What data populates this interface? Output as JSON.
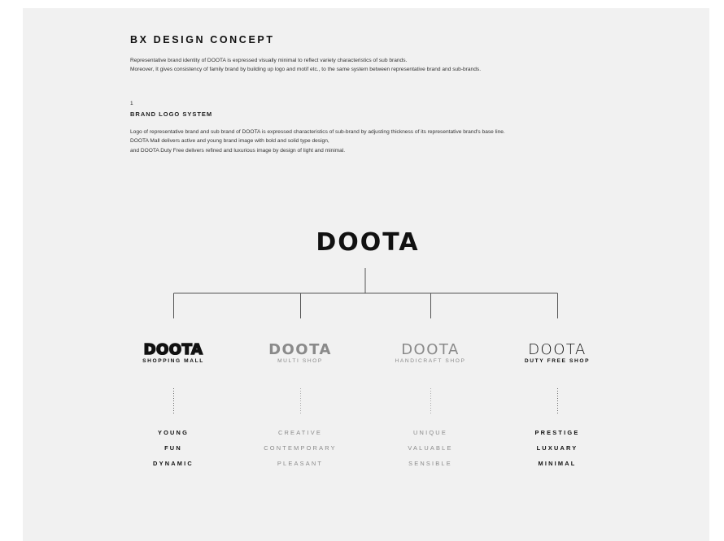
{
  "header": {
    "title": "BX DESIGN CONCEPT",
    "intro_lines": [
      "Representative brand identity of DOOTA is expressed visually minimal to reflect variety characteristics of sub brands.",
      "Moreover, It gives consistency of family brand by building up logo and motif etc., to the same system between representative brand and sub-brands."
    ]
  },
  "section": {
    "number": "1",
    "title": "BRAND LOGO SYSTEM",
    "body_lines": [
      "Logo of representative brand and sub brand of DOOTA is expressed characteristics of sub-brand by adjusting thickness of its representative brand's base line.",
      "DOOTA Mall delivers active and young brand image with bold and solid type design,",
      "and DOOTA Duty Free delivers refined and luxurious image by design of light and minimal."
    ]
  },
  "main_logo": {
    "text": "DOOTA"
  },
  "sub_brands": [
    {
      "logo": "DOOTA",
      "name": "SHOPPING MALL",
      "keywords": [
        "YOUNG",
        "FUN",
        "DYNAMIC"
      ]
    },
    {
      "logo": "DOOTA",
      "name": "MULTI SHOP",
      "keywords": [
        "CREATIVE",
        "CONTEMPORARY",
        "PLEASANT"
      ]
    },
    {
      "logo": "DOOTA",
      "name": "HANDICRAFT SHOP",
      "keywords": [
        "UNIQUE",
        "VALUABLE",
        "SENSIBLE"
      ]
    },
    {
      "logo": "DOOTA",
      "name": "DUTY FREE SHOP",
      "keywords": [
        "PRESTIGE",
        "LUXUARY",
        "MINIMAL"
      ]
    }
  ],
  "colors": {
    "background": "#f1f1f1",
    "dark": "#111111",
    "muted": "#8a8a8a",
    "line": "#555555"
  }
}
